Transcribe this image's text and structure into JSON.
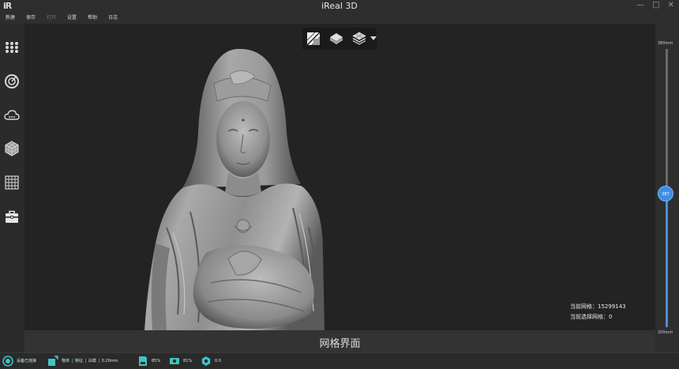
{
  "window": {
    "logo": "iR",
    "title": "iReal 3D",
    "controls": {
      "minimize": "—",
      "maximize": "□",
      "close": "✕"
    }
  },
  "menu": {
    "items": [
      {
        "label": "新建",
        "enabled": true
      },
      {
        "label": "保存",
        "enabled": true
      },
      {
        "label": "打开",
        "enabled": false
      },
      {
        "label": "设置",
        "enabled": true
      },
      {
        "label": "帮助",
        "enabled": true
      },
      {
        "label": "日志",
        "enabled": true
      }
    ]
  },
  "sidebar": {
    "icons": [
      "dots-grid-icon",
      "scan-target-icon",
      "cloud-icon",
      "mesh-cube-icon",
      "grid-icon",
      "toolbox-icon"
    ]
  },
  "toolbar": {
    "icons": [
      "mesh-view-icon",
      "layer-solid-icon",
      "layer-texture-icon",
      "dropdown-arrow-icon"
    ]
  },
  "viewport": {
    "mesh_info": {
      "current_mesh": "当前网格：15299143",
      "selected_mesh": "当前选择网格：0"
    },
    "footer_label": "网格界面"
  },
  "depth_slider": {
    "max_label": "380mm",
    "min_label": "200mm",
    "value_label": "287",
    "value_fraction": 0.48,
    "accent_color": "#3f8ee4"
  },
  "statusbar": {
    "connection": "设备已连接",
    "scan_mode_object": "物体",
    "scan_mode_feature": "特征",
    "scan_mode_white": "白模",
    "resolution": "0.20mm",
    "storage": "85%",
    "memory": "81%",
    "fps": "0.0",
    "accent_color": "#3fc4c4"
  }
}
